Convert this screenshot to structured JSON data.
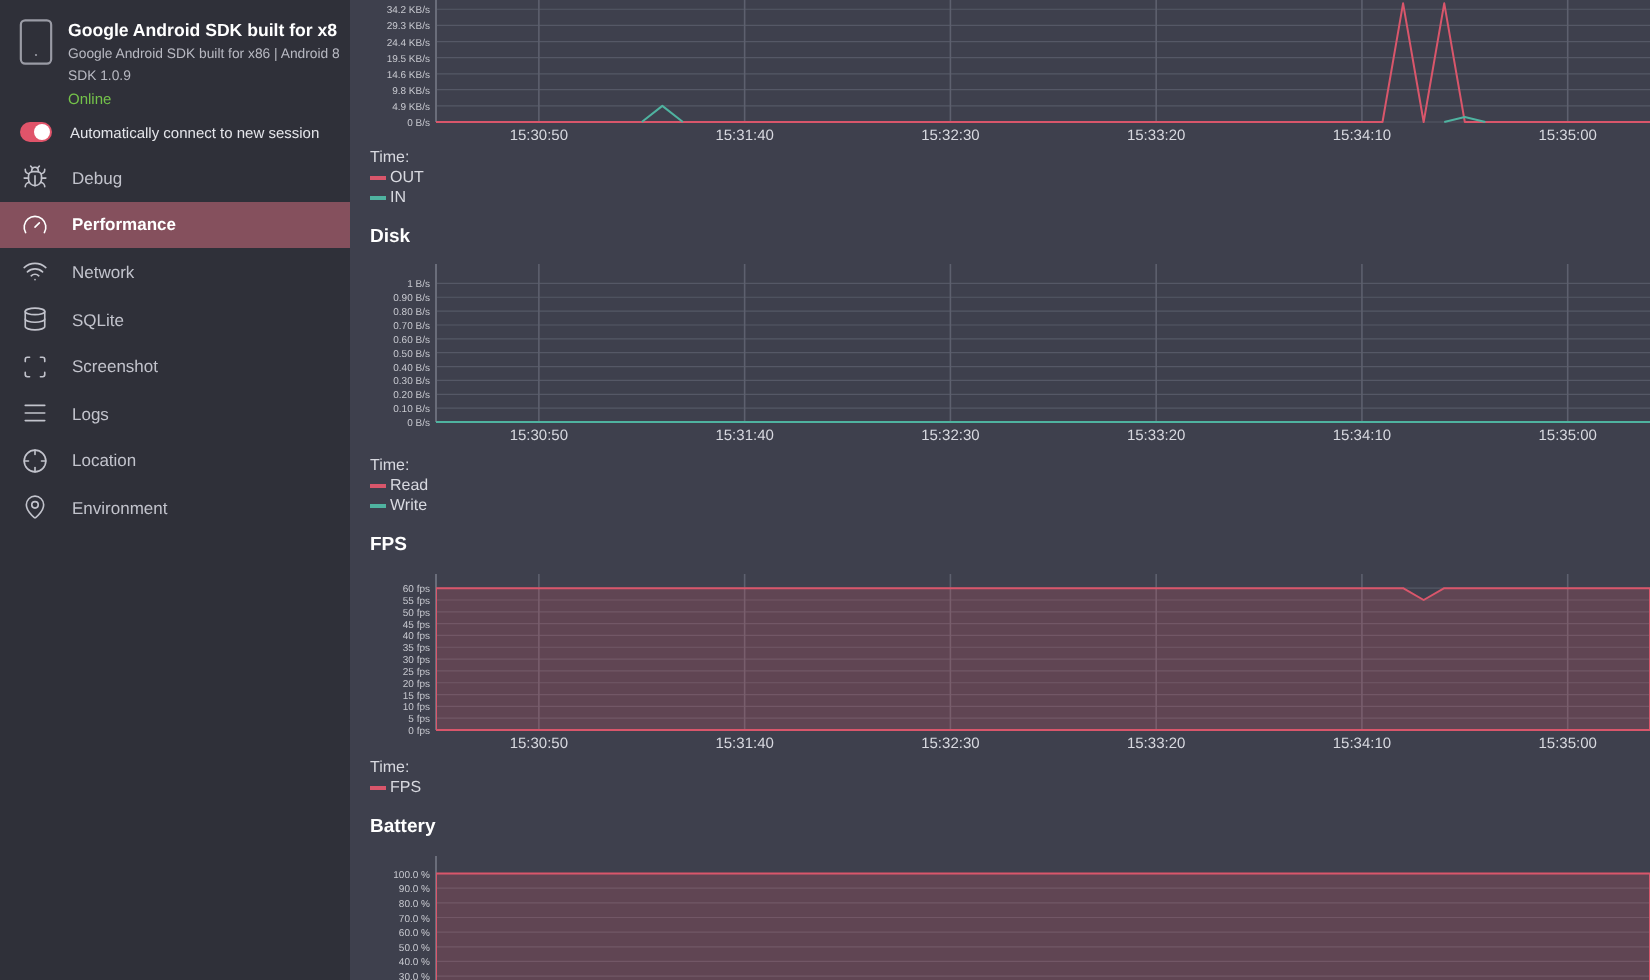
{
  "device": {
    "name": "Google Android SDK built for x8",
    "description": "Google Android SDK built for x86 | Android 8",
    "sdk": "SDK 1.0.9",
    "status": "Online"
  },
  "auto_connect": {
    "label": "Automatically connect to new session",
    "on": true
  },
  "nav": [
    {
      "label": "Debug",
      "selected": false
    },
    {
      "label": "Performance",
      "selected": true
    },
    {
      "label": "Network",
      "selected": false
    },
    {
      "label": "SQLite",
      "selected": false
    },
    {
      "label": "Screenshot",
      "selected": false
    },
    {
      "label": "Logs",
      "selected": false
    },
    {
      "label": "Location",
      "selected": false
    },
    {
      "label": "Environment",
      "selected": false
    }
  ],
  "sections": [
    {
      "time_label": "Time:",
      "chart_data": {
        "type": "line",
        "grid": true,
        "ylim": [
          0,
          37
        ],
        "categories": [
          null,
          null,
          null,
          null,
          null,
          "15:30:50",
          null,
          null,
          null,
          null,
          null,
          null,
          null,
          null,
          null,
          "15:31:40",
          null,
          null,
          null,
          null,
          null,
          null,
          null,
          null,
          null,
          "15:32:30",
          null,
          null,
          null,
          null,
          null,
          null,
          null,
          null,
          null,
          "15:33:20",
          null,
          null,
          null,
          null,
          null,
          null,
          null,
          null,
          null,
          "15:34:10",
          null,
          null,
          null,
          null,
          null,
          null,
          null,
          null,
          null,
          "15:35:00",
          null,
          null,
          null,
          null
        ],
        "yticks": [
          {
            "value": 0,
            "label": "0 B/s"
          },
          {
            "value": 4.9,
            "label": "4.9 KB/s"
          },
          {
            "value": 9.8,
            "label": "9.8 KB/s"
          },
          {
            "value": 14.6,
            "label": "14.6 KB/s"
          },
          {
            "value": 19.5,
            "label": "19.5 KB/s"
          },
          {
            "value": 24.4,
            "label": "24.4 KB/s"
          },
          {
            "value": 29.3,
            "label": "29.3 KB/s"
          },
          {
            "value": 34.2,
            "label": "34.2 KB/s"
          }
        ],
        "series": [
          {
            "name": "OUT",
            "color": "#d9566b",
            "values": [
              0,
              0,
              0,
              0,
              0,
              0,
              0,
              0,
              0,
              0,
              0,
              0,
              0,
              0,
              0,
              0,
              0,
              0,
              0,
              0,
              0,
              0,
              0,
              0,
              0,
              0,
              0,
              0,
              0,
              0,
              0,
              0,
              0,
              0,
              0,
              0,
              0,
              0,
              0,
              0,
              0,
              0,
              0,
              0,
              0,
              0,
              0,
              36,
              0,
              36,
              0,
              0,
              0,
              0,
              0,
              0,
              0,
              0,
              0,
              0
            ]
          },
          {
            "name": "IN",
            "color": "#4fb3a0",
            "values": [
              null,
              null,
              null,
              null,
              null,
              null,
              null,
              null,
              null,
              null,
              0,
              4.9,
              0,
              null,
              null,
              null,
              null,
              null,
              null,
              null,
              null,
              null,
              null,
              null,
              null,
              null,
              null,
              null,
              null,
              null,
              null,
              null,
              null,
              null,
              null,
              null,
              null,
              null,
              null,
              null,
              null,
              null,
              null,
              null,
              null,
              null,
              null,
              null,
              null,
              0,
              1.5,
              0,
              null,
              null,
              null,
              null,
              null,
              null,
              null,
              null
            ]
          }
        ]
      }
    },
    {
      "title": "Disk",
      "time_label": "Time:",
      "chart_data": {
        "type": "line",
        "grid": true,
        "ylim": [
          0,
          1.14
        ],
        "categories": [
          null,
          null,
          null,
          null,
          null,
          "15:30:50",
          null,
          null,
          null,
          null,
          null,
          null,
          null,
          null,
          null,
          "15:31:40",
          null,
          null,
          null,
          null,
          null,
          null,
          null,
          null,
          null,
          "15:32:30",
          null,
          null,
          null,
          null,
          null,
          null,
          null,
          null,
          null,
          "15:33:20",
          null,
          null,
          null,
          null,
          null,
          null,
          null,
          null,
          null,
          "15:34:10",
          null,
          null,
          null,
          null,
          null,
          null,
          null,
          null,
          null,
          "15:35:00",
          null,
          null,
          null,
          null
        ],
        "yticks": [
          {
            "value": 0,
            "label": "0 B/s"
          },
          {
            "value": 0.1,
            "label": "0.10 B/s"
          },
          {
            "value": 0.2,
            "label": "0.20 B/s"
          },
          {
            "value": 0.3,
            "label": "0.30 B/s"
          },
          {
            "value": 0.4,
            "label": "0.40 B/s"
          },
          {
            "value": 0.5,
            "label": "0.50 B/s"
          },
          {
            "value": 0.6,
            "label": "0.60 B/s"
          },
          {
            "value": 0.7,
            "label": "0.70 B/s"
          },
          {
            "value": 0.8,
            "label": "0.80 B/s"
          },
          {
            "value": 0.9,
            "label": "0.90 B/s"
          },
          {
            "value": 1,
            "label": "1 B/s"
          }
        ],
        "series": [
          {
            "name": "Read",
            "color": "#d9566b",
            "values": [
              null,
              null,
              null,
              null,
              null,
              null,
              null,
              null,
              null,
              null,
              null,
              null,
              null,
              null,
              null,
              null,
              null,
              null,
              null,
              null,
              null,
              null,
              null,
              null,
              null,
              null,
              null,
              null,
              null,
              null,
              null,
              null,
              null,
              null,
              null,
              null,
              null,
              null,
              null,
              null,
              null,
              null,
              null,
              null,
              null,
              null,
              null,
              null,
              null,
              null,
              null,
              null,
              null,
              null,
              null,
              null,
              null,
              null,
              null,
              null
            ]
          },
          {
            "name": "Write",
            "color": "#4fb3a0",
            "values": [
              0,
              0,
              0,
              0,
              0,
              0,
              0,
              0,
              0,
              0,
              0,
              0,
              0,
              0,
              0,
              0,
              0,
              0,
              0,
              0,
              0,
              0,
              0,
              0,
              0,
              0,
              0,
              0,
              0,
              0,
              0,
              0,
              0,
              0,
              0,
              0,
              0,
              0,
              0,
              0,
              0,
              0,
              0,
              0,
              0,
              0,
              0,
              0,
              0,
              0,
              0,
              0,
              0,
              0,
              0,
              0,
              0,
              0,
              0,
              0
            ]
          }
        ]
      }
    },
    {
      "title": "FPS",
      "time_label": "Time:",
      "chart_data": {
        "type": "area",
        "grid": true,
        "ylim": [
          0,
          66
        ],
        "categories": [
          null,
          null,
          null,
          null,
          null,
          "15:30:50",
          null,
          null,
          null,
          null,
          null,
          null,
          null,
          null,
          null,
          "15:31:40",
          null,
          null,
          null,
          null,
          null,
          null,
          null,
          null,
          null,
          "15:32:30",
          null,
          null,
          null,
          null,
          null,
          null,
          null,
          null,
          null,
          "15:33:20",
          null,
          null,
          null,
          null,
          null,
          null,
          null,
          null,
          null,
          "15:34:10",
          null,
          null,
          null,
          null,
          null,
          null,
          null,
          null,
          null,
          "15:35:00",
          null,
          null,
          null,
          null
        ],
        "yticks": [
          {
            "value": 0,
            "label": "0 fps"
          },
          {
            "value": 5,
            "label": "5 fps"
          },
          {
            "value": 10,
            "label": "10 fps"
          },
          {
            "value": 15,
            "label": "15 fps"
          },
          {
            "value": 20,
            "label": "20 fps"
          },
          {
            "value": 25,
            "label": "25 fps"
          },
          {
            "value": 30,
            "label": "30 fps"
          },
          {
            "value": 35,
            "label": "35 fps"
          },
          {
            "value": 40,
            "label": "40 fps"
          },
          {
            "value": 45,
            "label": "45 fps"
          },
          {
            "value": 50,
            "label": "50 fps"
          },
          {
            "value": 55,
            "label": "55 fps"
          },
          {
            "value": 60,
            "label": "60 fps"
          }
        ],
        "series": [
          {
            "name": "FPS",
            "color": "#d9566b",
            "values": [
              60,
              60,
              60,
              60,
              60,
              60,
              60,
              60,
              60,
              60,
              60,
              60,
              60,
              60,
              60,
              60,
              60,
              60,
              60,
              60,
              60,
              60,
              60,
              60,
              60,
              60,
              60,
              60,
              60,
              60,
              60,
              60,
              60,
              60,
              60,
              60,
              60,
              60,
              60,
              60,
              60,
              60,
              60,
              60,
              60,
              60,
              60,
              60,
              55,
              60,
              60,
              60,
              60,
              60,
              60,
              60,
              60,
              60,
              60,
              60
            ]
          }
        ]
      }
    },
    {
      "title": "Battery",
      "chart_data": {
        "type": "area",
        "grid": true,
        "ylim": [
          0,
          112
        ],
        "yticks": [
          {
            "value": 30,
            "label": "30.0 %"
          },
          {
            "value": 40,
            "label": "40.0 %"
          },
          {
            "value": 50,
            "label": "50.0 %"
          },
          {
            "value": 60,
            "label": "60.0 %"
          },
          {
            "value": 70,
            "label": "70.0 %"
          },
          {
            "value": 80,
            "label": "80.0 %"
          },
          {
            "value": 90,
            "label": "90.0 %"
          },
          {
            "value": 100,
            "label": "100.0 %"
          }
        ],
        "series": [
          {
            "color": "#d9566b",
            "values": [
              100,
              100,
              100,
              100,
              100,
              100,
              100,
              100,
              100,
              100,
              100,
              100,
              100,
              100,
              100,
              100,
              100,
              100,
              100,
              100,
              100,
              100,
              100,
              100,
              100,
              100,
              100,
              100,
              100,
              100,
              100,
              100,
              100,
              100,
              100,
              100,
              100,
              100,
              100,
              100,
              100,
              100,
              100,
              100,
              100,
              100,
              100,
              100,
              100,
              100,
              100,
              100,
              100,
              100,
              100,
              100,
              100,
              100,
              100,
              100
            ]
          }
        ]
      }
    }
  ]
}
